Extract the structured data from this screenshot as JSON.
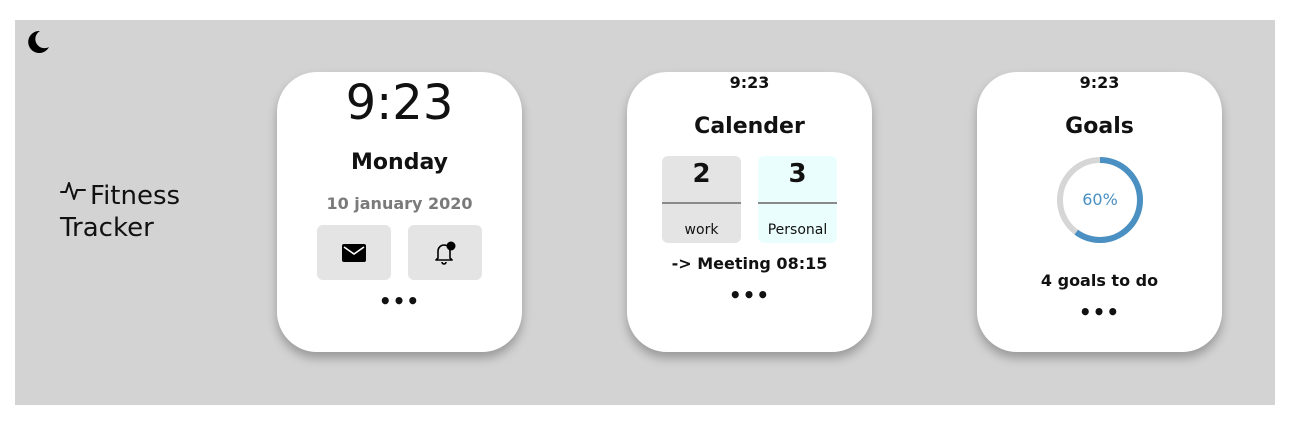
{
  "brand": {
    "icon": "activity-icon",
    "line1": "Fitness",
    "line2": "Tracker"
  },
  "theme_toggle": {
    "icon": "moon-icon"
  },
  "watch_home": {
    "time": "9:23",
    "day": "Monday",
    "date": "10 january 2020",
    "buttons": [
      {
        "icon": "mail-icon"
      },
      {
        "icon": "bell-notification-icon"
      }
    ],
    "more": "•••"
  },
  "watch_calendar": {
    "time": "9:23",
    "title": "Calender",
    "boxes": [
      {
        "count": "2",
        "label": "work",
        "color": "#e4e4e4"
      },
      {
        "count": "3",
        "label": "Personal",
        "color": "#eafffd"
      }
    ],
    "meeting": "-> Meeting 08:15",
    "more": "•••"
  },
  "watch_goals": {
    "time": "9:23",
    "title": "Goals",
    "progress_percent": 60,
    "progress_label": "60%",
    "progress_color": "#4a90c2",
    "track_color": "#d6d6d6",
    "todo": "4 goals to do",
    "more": "•••"
  }
}
